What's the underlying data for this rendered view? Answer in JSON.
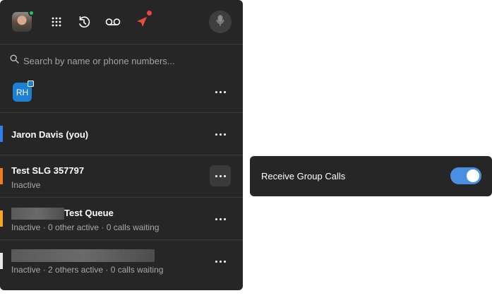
{
  "toolbar": {
    "icons": [
      "avatar",
      "dialpad-icon",
      "history-icon",
      "voicemail-icon",
      "send-icon",
      "microphone-icon"
    ],
    "colors": {
      "presence": "#22c55e",
      "notification": "#ef4444",
      "send_icon": "#e74c3c"
    }
  },
  "search": {
    "placeholder": "Search by name or phone numbers..."
  },
  "account": {
    "initials": "RH",
    "badge_color": "#1d80d2"
  },
  "lines": [
    {
      "title": "Jaron Davis (you)",
      "subtitle": "",
      "bar_color": "#2f80ed",
      "name_redacted": false
    },
    {
      "title": "Test SLG 357797",
      "subtitle": "Inactive",
      "bar_color": "#f07c1e",
      "name_redacted": false
    },
    {
      "title": "Test Queue",
      "subtitle": "Inactive · 0 other active · 0 calls waiting",
      "bar_color": "#f5a623",
      "name_redacted": true
    },
    {
      "title": "",
      "subtitle": "Inactive · 2 others active · 0 calls waiting",
      "bar_color": "#e8e8e8",
      "name_redacted": true
    }
  ],
  "popover": {
    "label": "Receive Group Calls",
    "toggle_on": true,
    "toggle_color": "#4a90e2"
  }
}
